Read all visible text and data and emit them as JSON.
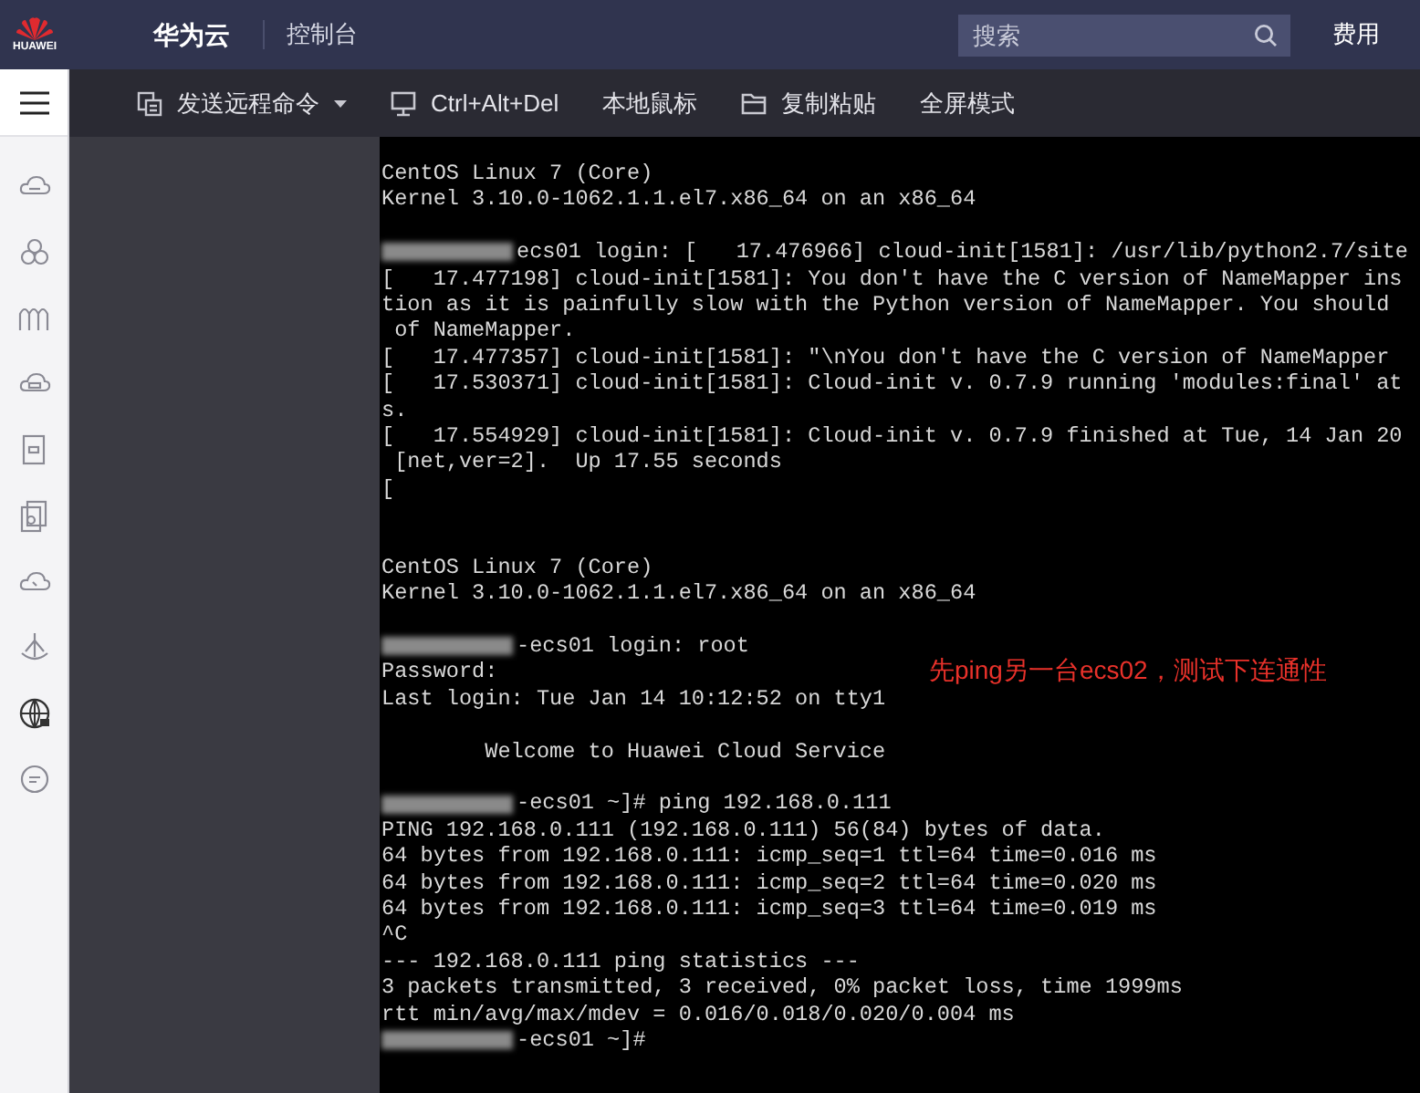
{
  "header": {
    "brand": "HUAWEI",
    "product": "华为云",
    "console": "控制台",
    "search": {
      "placeholder": "搜索"
    },
    "billing": "费用"
  },
  "toolbar": [
    {
      "label": "发送远程命令",
      "kind": "dropdown"
    },
    {
      "label": "Ctrl+Alt+Del",
      "kind": "monitor"
    },
    {
      "label": "本地鼠标",
      "kind": "plain"
    },
    {
      "label": "复制粘贴",
      "kind": "folder"
    },
    {
      "label": "全屏模式",
      "kind": "plain"
    }
  ],
  "terminal": {
    "annotation": "先ping另一台ecs02，测试下连通性",
    "lines": [
      {
        "text": "CentOS Linux 7 (Core)",
        "redacted": false
      },
      {
        "text": "Kernel 3.10.0-1062.1.1.el7.x86_64 on an x86_64",
        "redacted": false
      },
      {
        "redacted": false
      },
      {
        "text": "ecs01 login: [   17.476966] cloud-init[1581]: /usr/lib/python2.7/site",
        "redacted": true
      },
      {
        "text": "[   17.477198] cloud-init[1581]: You don't have the C version of NameMapper ins",
        "redacted": false
      },
      {
        "text": "tion as it is painfully slow with the Python version of NameMapper. You should",
        "redacted": false
      },
      {
        "text": " of NameMapper.",
        "redacted": false
      },
      {
        "text": "[   17.477357] cloud-init[1581]: \"\\nYou don't have the C version of NameMapper",
        "redacted": false
      },
      {
        "text": "[   17.530371] cloud-init[1581]: Cloud-init v. 0.7.9 running 'modules:final' at",
        "redacted": false
      },
      {
        "text": "s.",
        "redacted": false
      },
      {
        "text": "[   17.554929] cloud-init[1581]: Cloud-init v. 0.7.9 finished at Tue, 14 Jan 20",
        "redacted": false
      },
      {
        "text": " [net,ver=2].  Up 17.55 seconds",
        "redacted": false
      },
      {
        "text": "[",
        "redacted": false
      },
      {
        "redacted": false
      },
      {
        "redacted": false
      },
      {
        "text": "CentOS Linux 7 (Core)",
        "redacted": false
      },
      {
        "text": "Kernel 3.10.0-1062.1.1.el7.x86_64 on an x86_64",
        "redacted": false
      },
      {
        "redacted": false
      },
      {
        "text": "-ecs01 login: root",
        "redacted": true
      },
      {
        "text": "Password:",
        "redacted": false
      },
      {
        "text": "Last login: Tue Jan 14 10:12:52 on tty1",
        "redacted": false
      },
      {
        "redacted": false
      },
      {
        "text": "        Welcome to Huawei Cloud Service",
        "redacted": false
      },
      {
        "redacted": false
      },
      {
        "text": "-ecs01 ~]# ping 192.168.0.111",
        "redacted": true
      },
      {
        "text": "PING 192.168.0.111 (192.168.0.111) 56(84) bytes of data.",
        "redacted": false
      },
      {
        "text": "64 bytes from 192.168.0.111: icmp_seq=1 ttl=64 time=0.016 ms",
        "redacted": false
      },
      {
        "text": "64 bytes from 192.168.0.111: icmp_seq=2 ttl=64 time=0.020 ms",
        "redacted": false
      },
      {
        "text": "64 bytes from 192.168.0.111: icmp_seq=3 ttl=64 time=0.019 ms",
        "redacted": false
      },
      {
        "text": "^C",
        "redacted": false
      },
      {
        "text": "--- 192.168.0.111 ping statistics ---",
        "redacted": false
      },
      {
        "text": "3 packets transmitted, 3 received, 0% packet loss, time 1999ms",
        "redacted": false
      },
      {
        "text": "rtt min/avg/max/mdev = 0.016/0.018/0.020/0.004 ms",
        "redacted": false
      },
      {
        "text": "-ecs01 ~]#",
        "redacted": true
      }
    ]
  }
}
